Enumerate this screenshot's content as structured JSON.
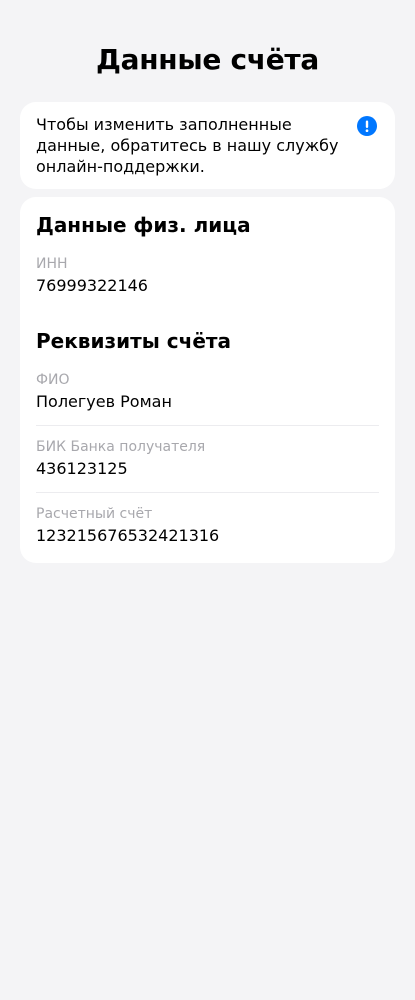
{
  "header": {
    "title": "Данные счёта"
  },
  "notice": {
    "text": "Чтобы изменить заполненные данные, обратитесь в нашу службу онлайн-поддержки.",
    "icon": "info-icon",
    "icon_color": "#0077ff"
  },
  "individual": {
    "title": "Данные физ. лица",
    "inn_label": "ИНН",
    "inn_value": "76999322146"
  },
  "account": {
    "title": "Реквизиты счёта",
    "fio_label": "ФИО",
    "fio_value": "Полегуев Роман",
    "bik_label": "БИК Банка получателя",
    "bik_value": "436123125",
    "account_label": "Расчетный счёт",
    "account_value": "123215676532421316"
  }
}
